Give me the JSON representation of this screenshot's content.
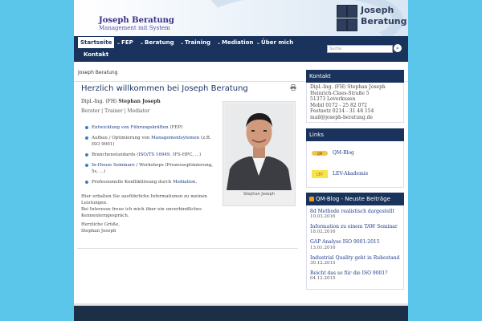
{
  "header": {
    "site_title": "Joseph Beratung",
    "site_subtitle": "Management mit System",
    "logo_line1": "Joseph",
    "logo_line2": "Beratung"
  },
  "nav": {
    "items": [
      {
        "label": "Startseite",
        "active": true,
        "has_dropdown": false
      },
      {
        "label": "FEP",
        "has_dropdown": true
      },
      {
        "label": "Beratung",
        "has_dropdown": true
      },
      {
        "label": "Training",
        "has_dropdown": true
      },
      {
        "label": "Mediation",
        "has_dropdown": true
      },
      {
        "label": "Über mich",
        "has_dropdown": true
      },
      {
        "label": "Kontakt",
        "has_dropdown": false
      }
    ],
    "search_placeholder": "Suche",
    "search_button_icon": "search-icon",
    "chevron_glyph": "⌄"
  },
  "breadcrumb": "Joseph Beratung",
  "main": {
    "title": "Herzlich willkommen bei Joseph Beratung",
    "author_prefix": "Dipl.-Ing. (FH) ",
    "author_name": "Stephan Joseph",
    "roles": "Berater | Trainer | Mediator",
    "bullets": [
      {
        "link": "Entwicklung von Führungskräften",
        "rest": " (FEP)"
      },
      {
        "pre": "Aufbau / Optimierung von ",
        "link": "Managementsytemen",
        "rest": " (z.B. ISO 9001)"
      },
      {
        "pre": "Branchenstandards (",
        "link": "ISO/TS 16949",
        "rest": ", IFS-HPC, ...)"
      },
      {
        "link": "In-House Seminare",
        "rest": " / Workshops (Prozessoptimierung, 5s, ...)"
      },
      {
        "pre": "Professionelle Konfliktlösung durch ",
        "link": "Mediation",
        "rest": "."
      }
    ],
    "para1_line1": "Hier erhalten Sie ausführliche Informationen zu meinen Leistungen.",
    "para1_line2": "Bei Interesse freue ich mich über ein unverbindliches Kennenlerngespräch.",
    "greeting": "Herzliche Grüße,",
    "signature": "Stephan Joseph",
    "photo_caption": "Stephan Joseph"
  },
  "sidebar": {
    "contact": {
      "heading": "Kontakt",
      "lines": [
        "Dipl.-Ing. (FH) Stephan Joseph",
        "Heinrich-Claes-Straße 5",
        "51373 Leverkusen",
        "Mobil 0172 - 25 82 072",
        "Festnetz 0214 - 31 48 154",
        "mail@joseph-beratung.de"
      ]
    },
    "links": {
      "heading": "Links",
      "items": [
        {
          "label": "QM-Blog",
          "icon": "qm-blog-logo-icon"
        },
        {
          "label": "LEV-Akademie",
          "icon": "lev-akademie-logo-icon"
        }
      ]
    },
    "blog": {
      "heading": "QM-Blog - Neuste Beiträge",
      "posts": [
        {
          "title": "8d Methode realistisch dargestellt",
          "date": "10.03.2016"
        },
        {
          "title": "Information zu einem TAW Seminar",
          "date": "18.02.2016"
        },
        {
          "title": "GAP Analyse ISO 9001:2015",
          "date": "13.01.2016",
          "inline_date": true
        },
        {
          "title": "Industrial Quality geht in Ruhestand",
          "date": "30.12.2015"
        },
        {
          "title": "Reicht das so für die ISO 9001?",
          "date": "04.12.2015"
        }
      ]
    }
  },
  "colors": {
    "background": "#5cc6ea",
    "nav": "#19335c",
    "title_purple": "#3a2f86",
    "link_blue": "#1a3a8a",
    "bullet_blue": "#3c7fc4"
  }
}
